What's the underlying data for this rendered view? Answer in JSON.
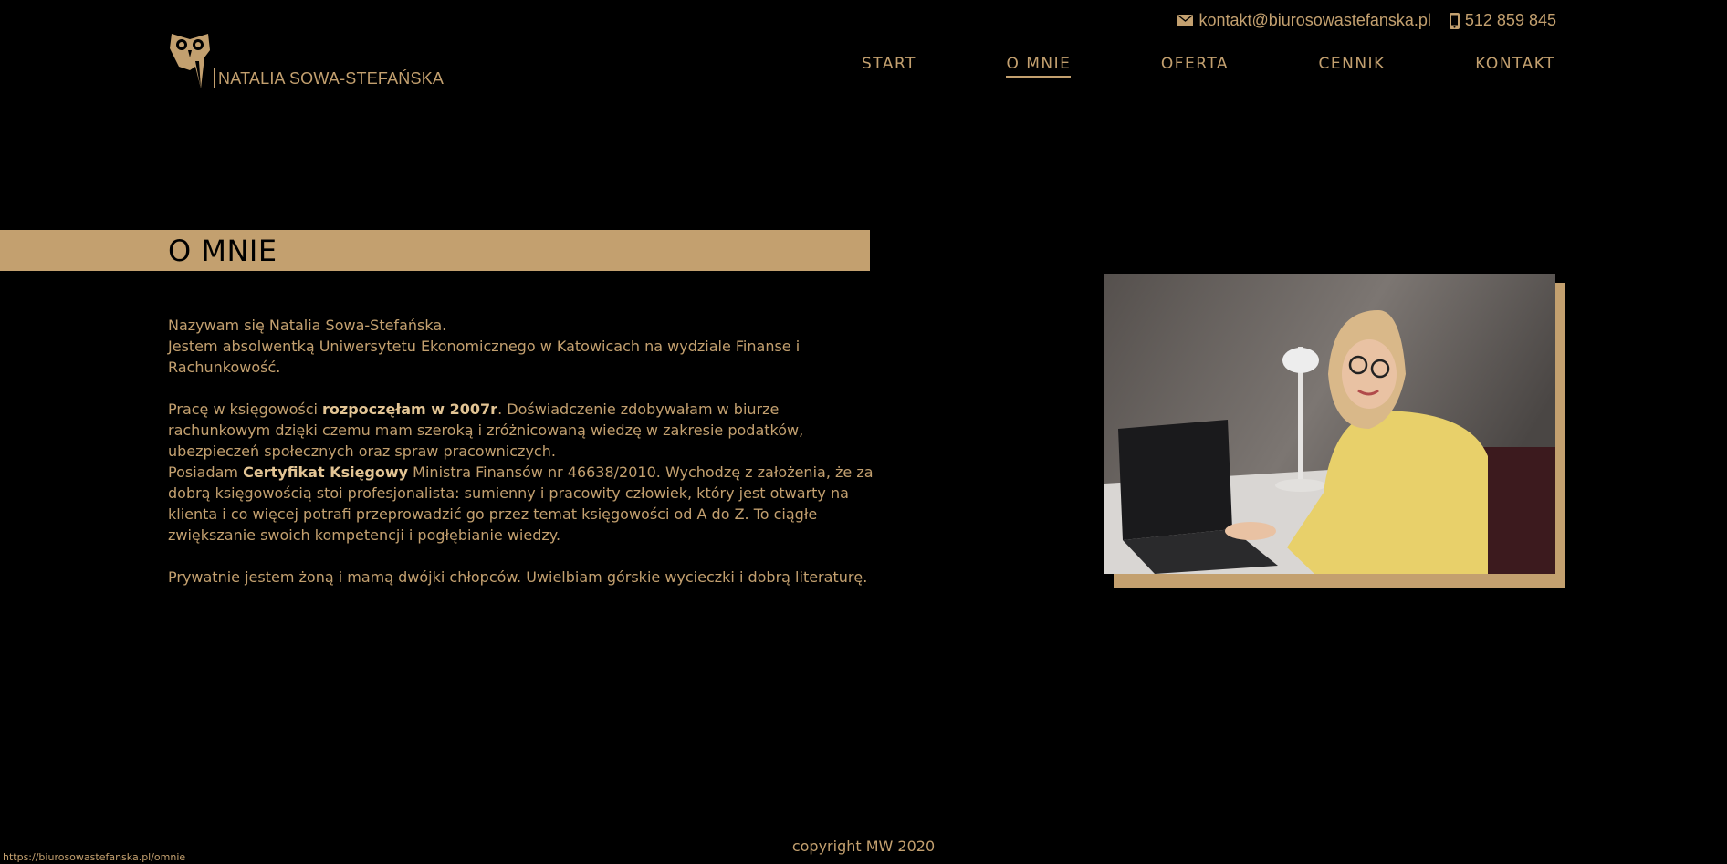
{
  "header": {
    "email": "kontakt@biurosowastefanska.pl",
    "phone": "512 859 845",
    "logo_text": "NATALIA SOWA-STEFAŃSKA",
    "email_icon": "envelope-icon",
    "phone_icon": "mobile-phone-icon",
    "logo_icon": "owl-icon"
  },
  "nav": {
    "items": [
      {
        "label": "START"
      },
      {
        "label": "O MNIE"
      },
      {
        "label": "OFERTA"
      },
      {
        "label": "CENNIK"
      },
      {
        "label": "KONTAKT"
      }
    ],
    "active_index": 1
  },
  "main": {
    "title": "O MNIE",
    "p1_line1": "Nazywam się Natalia Sowa-Stefańska.",
    "p1_line2": "Jestem absolwentką Uniwersytetu Ekonomicznego w Katowicach na wydziale Finanse i Rachunkowość.",
    "p2_a": "Pracę w księgowości ",
    "p2_b": "rozpoczęłam w 2007r",
    "p2_c": ". Doświadczenie zdobywałam w biurze rachunkowym dzięki czemu mam szeroką i zróżnicowaną wiedzę w zakresie podatków, ubezpieczeń społecznych oraz spraw pracowniczych.",
    "p2_d": "Posiadam ",
    "p2_e": "Certyfikat Księgowy",
    "p2_f": " Ministra Finansów nr 46638/2010. Wychodzę z założenia, że za dobrą księgowością stoi profesjonalista: sumienny i pracowity człowiek, który jest otwarty na klienta i co więcej potrafi przeprowadzić go przez temat księgowości od A do Z. To ciągłe zwiększanie swoich kompetencji i pogłębianie wiedzy.",
    "p3": "Prywatnie jestem żoną i mamą dwójki chłopców. Uwielbiam górskie wycieczki i dobrą literaturę."
  },
  "footer": {
    "copyright": "copyright MW 2020"
  },
  "status_url": "https://biurosowastefanska.pl/omnie",
  "colors": {
    "background": "#000000",
    "accent": "#c3a06f"
  }
}
